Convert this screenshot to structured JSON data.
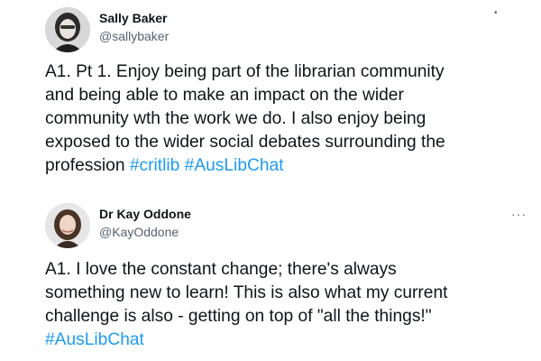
{
  "tweets": [
    {
      "author_name": "Sally Baker",
      "author_handle": "@sallybaker",
      "more_icon": "more-options-icon",
      "lines": [
        "A1. Pt 1. Enjoy being part of the librarian community",
        "and being able to make an impact on the wider",
        "community wth the work we do. I also enjoy being",
        "exposed to the wider social debates surrounding the",
        "profession "
      ],
      "hashtags": [
        "#critlib",
        "#AusLibChat"
      ]
    },
    {
      "author_name": "Dr Kay Oddone",
      "author_handle": "@KayOddone",
      "more_icon": "more-options-icon",
      "lines": [
        "A1. I love the constant change; there's always",
        "something new to learn! This is also what my current",
        "challenge is also - getting on top of \"all the things!\""
      ],
      "hashtags": [
        "#AusLibChat"
      ]
    }
  ],
  "colors": {
    "text": "#0f1419",
    "secondary": "#536471",
    "hashtag": "#1d9bf0"
  }
}
